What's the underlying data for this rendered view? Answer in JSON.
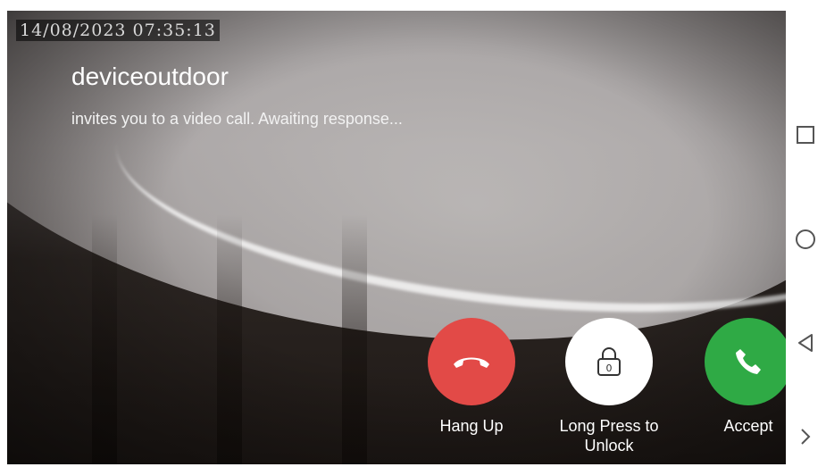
{
  "call": {
    "timestamp": "14/08/2023  07:35:13",
    "caller_name": "deviceoutdoor",
    "status": "invites you to a video call. Awaiting response..."
  },
  "actions": {
    "hang_up": {
      "label": "Hang Up",
      "color": "#e24a47",
      "icon": "phone-hangup-icon"
    },
    "unlock": {
      "label": "Long Press to Unlock",
      "icon_badge": "0",
      "color": "#ffffff",
      "icon": "lock-icon"
    },
    "accept": {
      "label": "Accept",
      "color": "#2faa45",
      "icon": "phone-icon"
    }
  },
  "nav": {
    "recents": "recents-square-icon",
    "home": "home-circle-icon",
    "back": "back-triangle-icon",
    "more": "chevron-right-icon"
  }
}
